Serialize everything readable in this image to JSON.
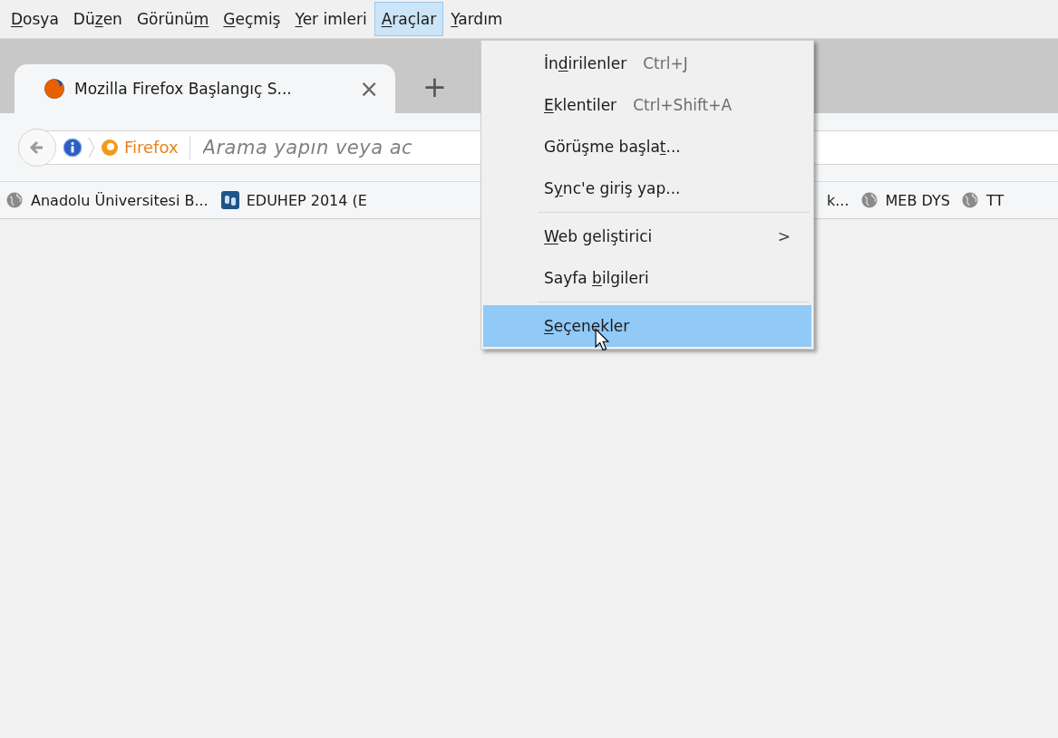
{
  "menu_bar": [
    {
      "key": "D",
      "post": "osya",
      "selected": false
    },
    {
      "pre": "Dü",
      "key": "z",
      "post": "en",
      "selected": false
    },
    {
      "pre": "Görünü",
      "key": "m",
      "selected": false
    },
    {
      "key": "G",
      "post": "eçmiş",
      "selected": false
    },
    {
      "key": "Y",
      "post": "er imleri",
      "selected": false
    },
    {
      "key": "A",
      "post": "raçlar",
      "selected": true
    },
    {
      "key": "Y",
      "post": "ardım",
      "selected": false
    }
  ],
  "tabs": [
    {
      "title": "Mozilla Firefox Başlangıç S...",
      "close": "×",
      "selected": true
    }
  ],
  "new_tab": "+",
  "toolbar": {
    "site_label": "Firefox",
    "placeholder": "Arama yapın veya ac"
  },
  "bookmarks_left": [
    {
      "label": "Anadolu Üniversitesi B...",
      "kind": "globe"
    },
    {
      "label": "EDUHEP 2014 (E",
      "kind": "ds"
    }
  ],
  "bookmarks_right": [
    {
      "label": "k...",
      "kind": "text"
    },
    {
      "label": "MEB DYS",
      "kind": "globe"
    },
    {
      "label": "TT",
      "kind": "globe"
    }
  ],
  "dropdown": [
    {
      "kind": "item",
      "pre": "İn",
      "key": "d",
      "post": "irilenler",
      "shortcut": "Ctrl+J",
      "selected": false
    },
    {
      "kind": "item",
      "key": "E",
      "post": "klentiler",
      "shortcut": "Ctrl+Shift+A",
      "selected": false
    },
    {
      "kind": "item",
      "pre": "Görüşme başla",
      "key": "t",
      "post": "...",
      "selected": false
    },
    {
      "kind": "item",
      "pre": "S",
      "key": "y",
      "post": "nc'e giriş yap...",
      "selected": false
    },
    {
      "kind": "separator"
    },
    {
      "kind": "submenu",
      "key": "W",
      "post": "eb geliştirici",
      "arrow": ">",
      "selected": false
    },
    {
      "kind": "item",
      "pre": "Sayfa ",
      "key": "b",
      "post": "ilgileri",
      "selected": false
    },
    {
      "kind": "separator"
    },
    {
      "kind": "item",
      "key": "S",
      "post": "eçenekler",
      "selected": true
    }
  ]
}
